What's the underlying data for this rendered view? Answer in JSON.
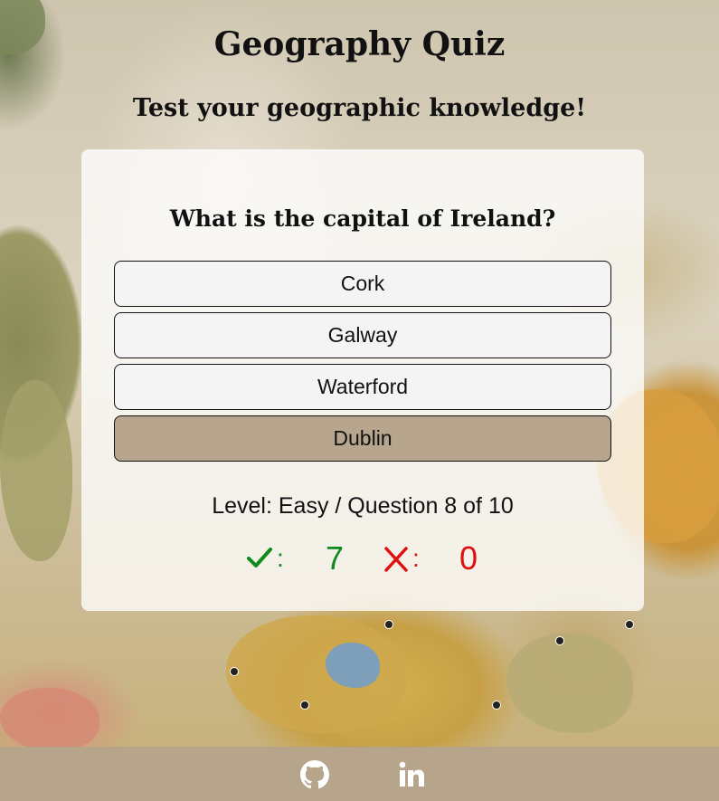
{
  "header": {
    "title": "Geography Quiz",
    "subtitle": "Test your geographic knowledge!"
  },
  "quiz": {
    "question": "What is the capital of Ireland?",
    "answers": [
      {
        "label": "Cork",
        "selected": false
      },
      {
        "label": "Galway",
        "selected": false
      },
      {
        "label": "Waterford",
        "selected": false
      },
      {
        "label": "Dublin",
        "selected": true
      }
    ],
    "level_text": "Level: Easy / Question 8 of 10",
    "score": {
      "correct_icon": "check-icon",
      "correct_separator": ":",
      "correct_count": "7",
      "wrong_icon": "cross-icon",
      "wrong_separator": ":",
      "wrong_count": "0"
    }
  },
  "colors": {
    "selected_answer": "#b7a68d",
    "correct": "#118a1c",
    "wrong": "#e01010",
    "footer": "#b6a58b"
  },
  "footer": {
    "icons": [
      "github-icon",
      "linkedin-icon"
    ]
  }
}
